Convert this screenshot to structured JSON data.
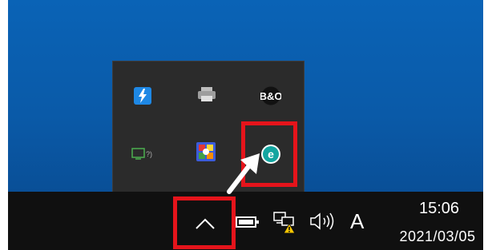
{
  "taskbar": {
    "clock": {
      "time": "15:06",
      "date": "2021/03/05"
    },
    "input_indicator": "A",
    "overflow_button": "show-hidden-icons"
  },
  "tray_popup": {
    "icons": [
      "thunderbolt-icon",
      "printer-icon",
      "bo-icon",
      "network-display-icon",
      "colorful-app-icon",
      "eset-icon"
    ]
  },
  "annotation": {
    "highlight_color": "#e5141b",
    "arrow_color": "#ffffff"
  }
}
